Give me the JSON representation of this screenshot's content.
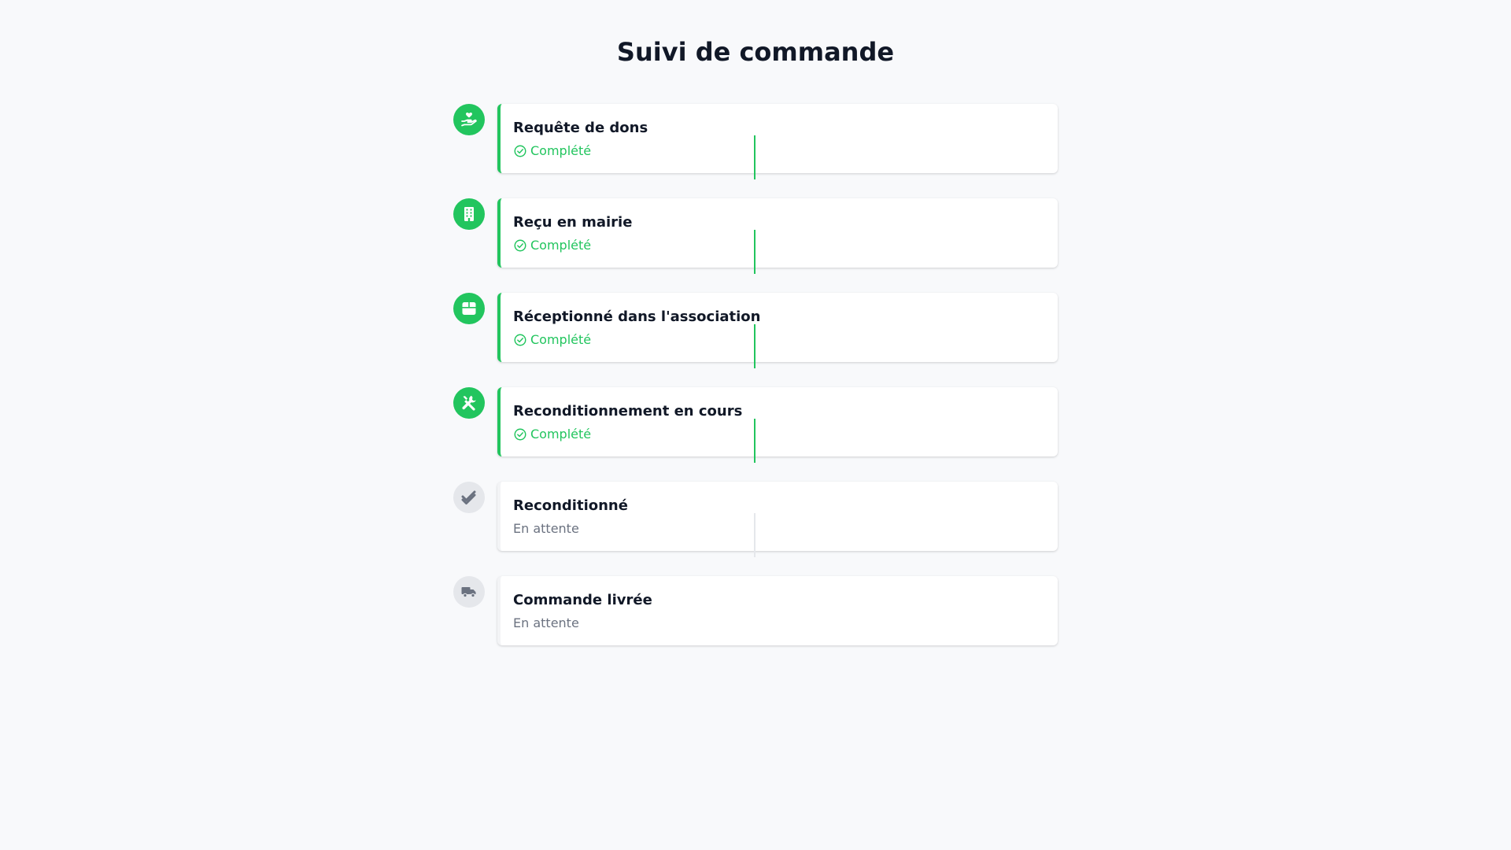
{
  "page": {
    "title": "Suivi de commande"
  },
  "colors": {
    "done": "#22c55e",
    "pending": "#e5e7eb",
    "pending_text": "#6b7280",
    "title_text": "#111827"
  },
  "steps": [
    {
      "title": "Requête de dons",
      "status": "Complété",
      "state": "done",
      "icon": "hand-heart-icon"
    },
    {
      "title": "Reçu en mairie",
      "status": "Complété",
      "state": "done",
      "icon": "building-icon"
    },
    {
      "title": "Réceptionné dans l'association",
      "status": "Complété",
      "state": "done",
      "icon": "box-icon"
    },
    {
      "title": "Reconditionnement en cours",
      "status": "Complété",
      "state": "done",
      "icon": "tools-icon"
    },
    {
      "title": "Reconditionné",
      "status": "En attente",
      "state": "pending",
      "icon": "double-check-icon"
    },
    {
      "title": "Commande livrée",
      "status": "En attente",
      "state": "pending",
      "icon": "truck-icon"
    }
  ]
}
